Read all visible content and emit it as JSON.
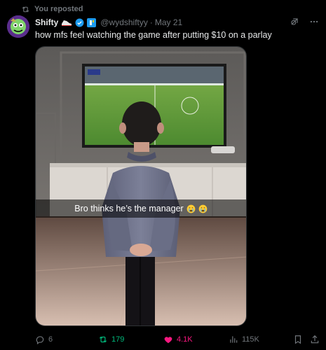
{
  "repost_label": "You reposted",
  "author": {
    "display_name": "Shifty",
    "handle": "@wydshiftyy",
    "separator": "·",
    "date": "May 21"
  },
  "tweet_text": "how mfs feel watching the game after putting $10 on a parlay",
  "media": {
    "caption": "Bro thinks he’s the manager"
  },
  "actions": {
    "replies": "6",
    "reposts": "179",
    "likes": "4.1K",
    "views": "115K"
  },
  "colors": {
    "repost_green": "#00ba7c",
    "like_pink": "#f91880",
    "verified_blue": "#1d9bf0",
    "muted": "#71767b"
  },
  "icons": [
    "repost-icon",
    "verified-badge-icon",
    "grok-icon",
    "more-icon",
    "reply-icon",
    "like-icon",
    "views-icon",
    "bookmark-icon",
    "share-icon"
  ]
}
